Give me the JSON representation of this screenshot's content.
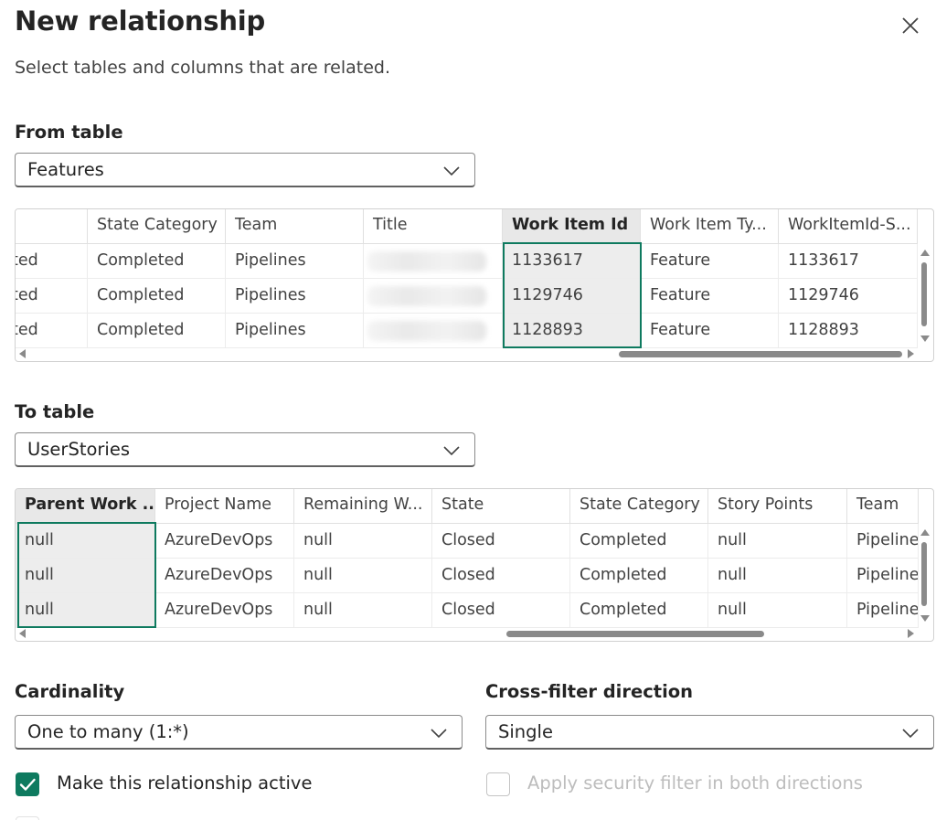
{
  "dialog": {
    "title": "New relationship",
    "subtitle": "Select tables and columns that are related.",
    "accent_color": "#0e7a5f"
  },
  "from_table": {
    "label": "From table",
    "selected": "Features",
    "columns": [
      "ted",
      "State Category",
      "Team",
      "Title",
      "Work Item Id",
      "Work Item Ty...",
      "WorkItemId-S..."
    ],
    "selected_column": "Work Item Id",
    "rows": [
      [
        "ted",
        "Completed",
        "Pipelines",
        "",
        "1133617",
        "Feature",
        "1133617"
      ],
      [
        "ted",
        "Completed",
        "Pipelines",
        "",
        "1129746",
        "Feature",
        "1129746"
      ],
      [
        "ted",
        "Completed",
        "Pipelines",
        "",
        "1128893",
        "Feature",
        "1128893"
      ]
    ]
  },
  "to_table": {
    "label": "To table",
    "selected": "UserStories",
    "columns": [
      "Parent Work ...",
      "Project Name",
      "Remaining W...",
      "State",
      "State Category",
      "Story Points",
      "Team"
    ],
    "selected_column": "Parent Work ...",
    "rows": [
      [
        "null",
        "AzureDevOps",
        "null",
        "Closed",
        "Completed",
        "null",
        "Pipelines"
      ],
      [
        "null",
        "AzureDevOps",
        "null",
        "Closed",
        "Completed",
        "null",
        "Pipelines"
      ],
      [
        "null",
        "AzureDevOps",
        "null",
        "Closed",
        "Completed",
        "null",
        "Pipelines"
      ]
    ]
  },
  "cardinality": {
    "label": "Cardinality",
    "selected": "One to many (1:*)"
  },
  "cross_filter": {
    "label": "Cross-filter direction",
    "selected": "Single"
  },
  "options": {
    "make_active_label": "Make this relationship active",
    "make_active_checked": true,
    "security_filter_label": "Apply security filter in both directions",
    "security_filter_checked": false,
    "security_filter_disabled": true
  }
}
